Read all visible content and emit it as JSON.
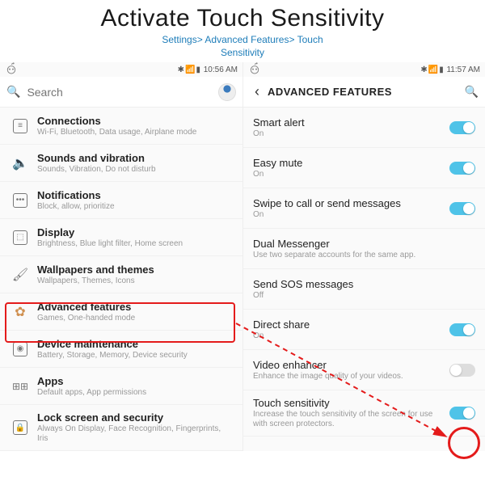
{
  "header": {
    "title": "Activate Touch Sensitivity",
    "breadcrumb": "Settings> Advanced Features> Touch\nSensitivity"
  },
  "colors": {
    "accent": "#4fc3e8",
    "annotate": "#e41b1b",
    "link": "#1e7db9"
  },
  "left_screen": {
    "status": {
      "time": "10:56 AM",
      "icons": "✱ ◢▮▮"
    },
    "search_placeholder": "Search",
    "items": [
      {
        "name": "connections",
        "title": "Connections",
        "sub": "Wi-Fi, Bluetooth, Data usage, Airplane mode"
      },
      {
        "name": "sounds",
        "title": "Sounds and vibration",
        "sub": "Sounds, Vibration, Do not disturb"
      },
      {
        "name": "notifications",
        "title": "Notifications",
        "sub": "Block, allow, prioritize"
      },
      {
        "name": "display",
        "title": "Display",
        "sub": "Brightness, Blue light filter, Home screen"
      },
      {
        "name": "wallpapers",
        "title": "Wallpapers and themes",
        "sub": "Wallpapers, Themes, Icons"
      },
      {
        "name": "advanced",
        "title": "Advanced features",
        "sub": "Games, One-handed mode"
      },
      {
        "name": "maintenance",
        "title": "Device maintenance",
        "sub": "Battery, Storage, Memory, Device security"
      },
      {
        "name": "apps",
        "title": "Apps",
        "sub": "Default apps, App permissions"
      },
      {
        "name": "lock",
        "title": "Lock screen and security",
        "sub": "Always On Display, Face Recognition, Fingerprints, Iris"
      }
    ]
  },
  "right_screen": {
    "status": {
      "time": "11:57 AM",
      "icons": "✱ ◢▮▮"
    },
    "header": "ADVANCED FEATURES",
    "items": [
      {
        "name": "smart-alert",
        "title": "Smart alert",
        "sub": "On",
        "toggle": true
      },
      {
        "name": "easy-mute",
        "title": "Easy mute",
        "sub": "On",
        "toggle": true
      },
      {
        "name": "swipe-call",
        "title": "Swipe to call or send messages",
        "sub": "On",
        "toggle": true
      },
      {
        "name": "dual-messenger",
        "title": "Dual Messenger",
        "sub": "Use two separate accounts for the same app.",
        "toggle": null
      },
      {
        "name": "sos",
        "title": "Send SOS messages",
        "sub": "Off",
        "toggle": null
      },
      {
        "name": "direct-share",
        "title": "Direct share",
        "sub": "On",
        "toggle": true
      },
      {
        "name": "video-enhancer",
        "title": "Video enhancer",
        "sub": "Enhance the image quality of your videos.",
        "toggle": false
      },
      {
        "name": "touch-sensitivity",
        "title": "Touch sensitivity",
        "sub": "Increase the touch sensitivity of the screen for use with screen protectors.",
        "toggle": true
      }
    ]
  }
}
